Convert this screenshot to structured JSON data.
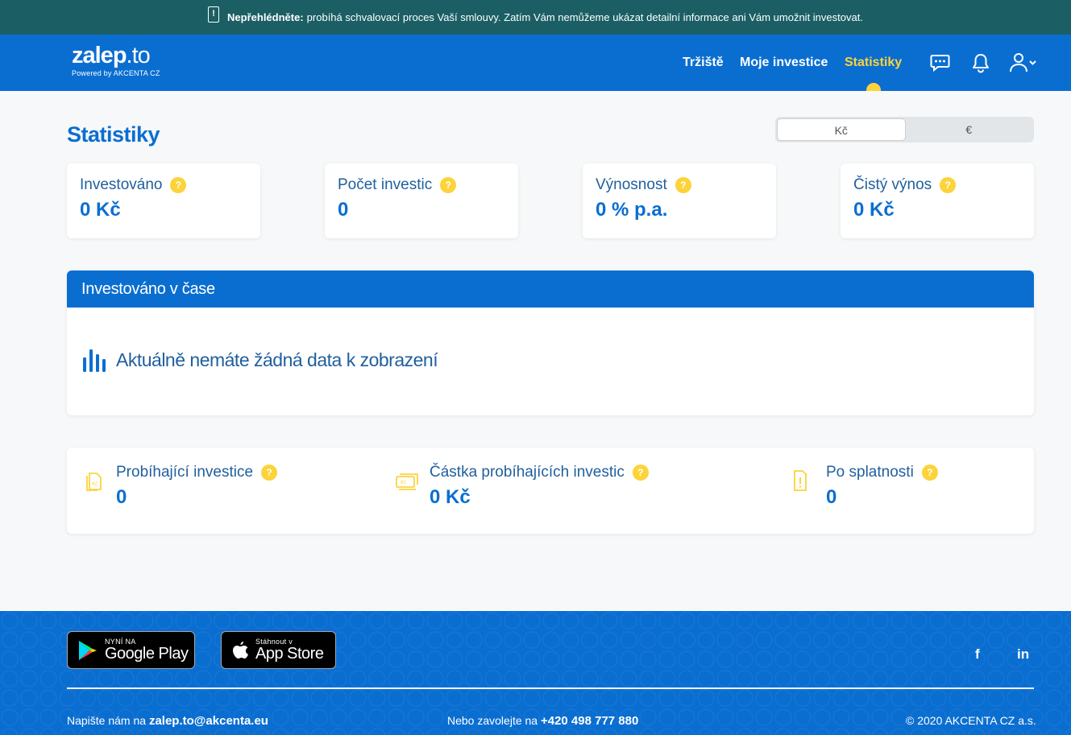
{
  "notice": {
    "strong": "Nepřehlédněte:",
    "text": "probíhá schvalovací proces Vaší smlouvy. Zatím Vám nemůžeme ukázat detailní informace ani Vám umožnit investovat."
  },
  "logo": {
    "name_main": "zalep",
    "name_tail": ".to",
    "powered": "Powered by AKCENTA CZ"
  },
  "nav": {
    "items": [
      {
        "label": "Tržiště"
      },
      {
        "label": "Moje investice"
      },
      {
        "label": "Statistiky"
      }
    ],
    "active": "Statistiky",
    "icons": [
      "chat-icon",
      "bell-icon",
      "user-icon"
    ]
  },
  "page": {
    "title": "Statistiky"
  },
  "currency": {
    "options": [
      "Kč",
      "€"
    ],
    "selected": "Kč"
  },
  "stats": [
    {
      "label": "Investováno",
      "value": "0 Kč"
    },
    {
      "label": "Počet investic",
      "value": "0"
    },
    {
      "label": "Výnosnost",
      "value": "0 % p.a."
    },
    {
      "label": "Čistý výnos",
      "value": "0 Kč"
    }
  ],
  "help_glyph": "?",
  "chart_panel": {
    "title": "Investováno v čase",
    "empty_text": "Aktuálně nemáte žádná data k zobrazení"
  },
  "bottom_stats": [
    {
      "label": "Probíhající investice",
      "value": "0",
      "icon": "documents-icon"
    },
    {
      "label": "Částka probíhajících investic",
      "value": "0 Kč",
      "icon": "banknotes-icon"
    },
    {
      "label": "Po splatnosti",
      "value": "0",
      "icon": "document-alert-icon"
    }
  ],
  "footer": {
    "google_play": {
      "small": "NYNÍ NA",
      "big": "Google Play"
    },
    "app_store": {
      "small": "Stáhnout v",
      "big": "App Store"
    },
    "social": [
      "f",
      "in"
    ],
    "write_prefix": "Napište nám na",
    "email": "zalep.to@akcenta.eu",
    "call_prefix": "Nebo zavolejte na",
    "phone": "+420 498 777 880",
    "copyright": "© 2020 AKCENTA CZ a.s."
  },
  "colors": {
    "brand": "#0a6ed1",
    "accent": "#fdd33a",
    "notice_bg": "#1b5f64"
  }
}
